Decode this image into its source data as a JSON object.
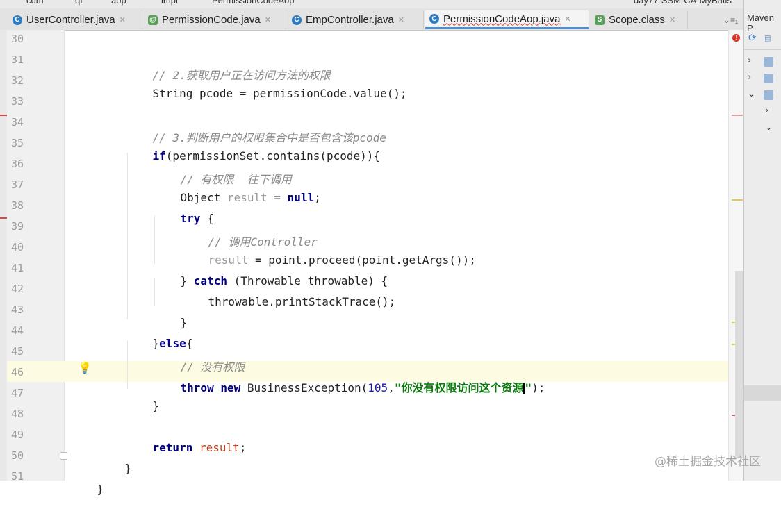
{
  "breadcrumb": [
    "com",
    "qf",
    "aop",
    "impl",
    "PermissionCodeAop",
    "day77-SSM-CA-MyBatis"
  ],
  "tabs": [
    {
      "label": "UserController.java",
      "active": false
    },
    {
      "label": "PermissionCode.java",
      "active": false
    },
    {
      "label": "EmpController.java",
      "active": false
    },
    {
      "label": "PermissionCodeAop.java",
      "active": true
    },
    {
      "label": "Scope.class",
      "active": false
    }
  ],
  "tab_controls": "⌄≡₁",
  "right_panel": {
    "title": "Maven P"
  },
  "watermark": "@稀土掘金技术社区",
  "editor": {
    "line_numbers": [
      "30",
      "31",
      "32",
      "33",
      "34",
      "35",
      "36",
      "37",
      "38",
      "39",
      "40",
      "41",
      "42",
      "43",
      "44",
      "45",
      "46",
      "47",
      "48",
      "49",
      "50",
      "51"
    ],
    "current_line": "46",
    "code": {
      "l31_comment": "// 2.获取用户正在访问方法的权限",
      "l32_type": "String ",
      "l32_var": "pcode",
      "l32_rest": " = permissionCode.value();",
      "l34_comment": "// 3.判断用户的权限集合中是否包含该pcode",
      "l35_kw": "if",
      "l35_rest": "(permissionSet.contains(pcode)){",
      "l36_comment": "// 有权限  往下调用",
      "l37_type": "Object ",
      "l37_var": "result",
      "l37_eq": " = ",
      "l37_null": "null",
      "l37_end": ";",
      "l38_kw": "try",
      "l38_rest": " {",
      "l39_comment": "// 调用Controller",
      "l40_var": "result",
      "l40_rest": " = point.proceed(point.getArgs());",
      "l41_open": "} ",
      "l41_kw": "catch",
      "l41_rest": " (Throwable throwable) {",
      "l42_code": "throwable.printStackTrace();",
      "l43_code": "}",
      "l44_open": "}",
      "l44_kw": "else",
      "l44_rest": "{",
      "l45_comment": "// 没有权限",
      "l46_kw1": "throw",
      "l46_kw2": "new",
      "l46_cls": " BusinessException(",
      "l46_num": "105",
      "l46_comma": ",",
      "l46_str": "\"你没有权限访问这个资源",
      "l46_str_end": "\"",
      "l46_end": ");",
      "l47_code": "}",
      "l49_kw": "return",
      "l49_var": "result",
      "l49_end": ";",
      "l50_code": "}",
      "l51_code": "}"
    }
  },
  "colors": {
    "keyword": "#000080",
    "comment": "#8a8a8a",
    "string": "#0b7a0b",
    "current_line_bg": "#fdfce3",
    "active_tab_underline": "#4b8fd4",
    "error": "#d9352a"
  }
}
